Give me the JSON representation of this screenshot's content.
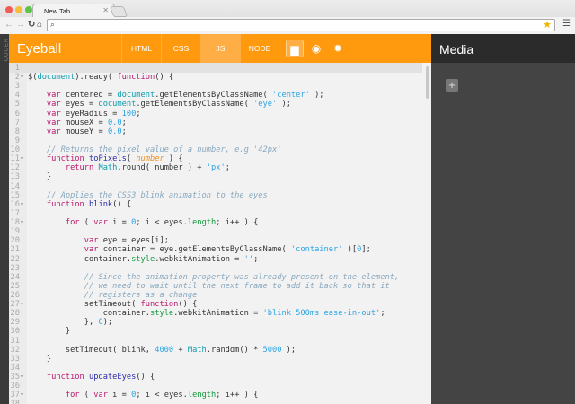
{
  "browser": {
    "tab_title": "New Tab",
    "url": ""
  },
  "sidebar_strip": {
    "label": "CODER"
  },
  "header": {
    "title": "Eyeball",
    "tabs": [
      "HTML",
      "CSS",
      "JS",
      "NODE"
    ],
    "active_tab": "JS",
    "accent": "#ff9a0f"
  },
  "media_panel": {
    "title": "Media",
    "add_label": "+"
  },
  "editor": {
    "active_line": 1,
    "warning_line": 29,
    "fold_lines": [
      2,
      11,
      16,
      18,
      27,
      35,
      37
    ],
    "lines": [
      [],
      [
        [
          "",
          "$("
        ],
        [
          "d",
          "document"
        ],
        [
          "",
          ").ready( "
        ],
        [
          "k",
          "function"
        ],
        [
          "",
          "() {"
        ]
      ],
      [],
      [
        [
          "",
          "    "
        ],
        [
          "k",
          "var"
        ],
        [
          "",
          " centered = "
        ],
        [
          "d",
          "document"
        ],
        [
          "",
          ".getElementsByClassName( "
        ],
        [
          "s",
          "'center'"
        ],
        [
          "",
          " );"
        ]
      ],
      [
        [
          "",
          "    "
        ],
        [
          "k",
          "var"
        ],
        [
          "",
          " eyes = "
        ],
        [
          "d",
          "document"
        ],
        [
          "",
          ".getElementsByClassName( "
        ],
        [
          "s",
          "'eye'"
        ],
        [
          "",
          " );"
        ]
      ],
      [
        [
          "",
          "    "
        ],
        [
          "k",
          "var"
        ],
        [
          "",
          " eyeRadius = "
        ],
        [
          "s",
          "100"
        ],
        [
          "",
          ";"
        ]
      ],
      [
        [
          "",
          "    "
        ],
        [
          "k",
          "var"
        ],
        [
          "",
          " mouseX = "
        ],
        [
          "s",
          "0.0"
        ],
        [
          "",
          ";"
        ]
      ],
      [
        [
          "",
          "    "
        ],
        [
          "k",
          "var"
        ],
        [
          "",
          " mouseY = "
        ],
        [
          "s",
          "0.0"
        ],
        [
          "",
          ";"
        ]
      ],
      [],
      [
        [
          "",
          "    "
        ],
        [
          "c",
          "// Returns the pixel value of a number, e.g '42px'"
        ]
      ],
      [
        [
          "",
          "    "
        ],
        [
          "k",
          "function"
        ],
        [
          "",
          " "
        ],
        [
          "f",
          "toPixels"
        ],
        [
          "",
          "( "
        ],
        [
          "p",
          "number"
        ],
        [
          "",
          " ) {"
        ]
      ],
      [
        [
          "",
          "        "
        ],
        [
          "k",
          "return"
        ],
        [
          "",
          " "
        ],
        [
          "d",
          "Math"
        ],
        [
          "",
          ".round( number ) + "
        ],
        [
          "s",
          "'px'"
        ],
        [
          "",
          ";"
        ]
      ],
      [
        [
          "",
          "    }"
        ]
      ],
      [],
      [
        [
          "",
          "    "
        ],
        [
          "c",
          "// Applies the CSS3 blink animation to the eyes"
        ]
      ],
      [
        [
          "",
          "    "
        ],
        [
          "k",
          "function"
        ],
        [
          "",
          " "
        ],
        [
          "f",
          "blink"
        ],
        [
          "",
          "() {"
        ]
      ],
      [],
      [
        [
          "",
          "        "
        ],
        [
          "k",
          "for"
        ],
        [
          "",
          " ( "
        ],
        [
          "k",
          "var"
        ],
        [
          "",
          " i = "
        ],
        [
          "s",
          "0"
        ],
        [
          "",
          "; i < eyes."
        ],
        [
          "g",
          "length"
        ],
        [
          "",
          "; i++ ) {"
        ]
      ],
      [],
      [
        [
          "",
          "            "
        ],
        [
          "k",
          "var"
        ],
        [
          "",
          " eye = eyes[i];"
        ]
      ],
      [
        [
          "",
          "            "
        ],
        [
          "k",
          "var"
        ],
        [
          "",
          " container = eye.getElementsByClassName( "
        ],
        [
          "s",
          "'container'"
        ],
        [
          "",
          " )["
        ],
        [
          "s",
          "0"
        ],
        [
          "",
          "];"
        ]
      ],
      [
        [
          "",
          "            container."
        ],
        [
          "g",
          "style"
        ],
        [
          "",
          ".webkitAnimation = "
        ],
        [
          "s",
          "''"
        ],
        [
          "",
          ";"
        ]
      ],
      [],
      [
        [
          "",
          "            "
        ],
        [
          "c",
          "// Since the animation property was already present on the element,"
        ]
      ],
      [
        [
          "",
          "            "
        ],
        [
          "c",
          "// we need to wait until the next frame to add it back so that it"
        ]
      ],
      [
        [
          "",
          "            "
        ],
        [
          "c",
          "// registers as a change"
        ]
      ],
      [
        [
          "",
          "            setTimeout( "
        ],
        [
          "k",
          "function"
        ],
        [
          "",
          "() {"
        ]
      ],
      [
        [
          "",
          "                container."
        ],
        [
          "g",
          "style"
        ],
        [
          "",
          ".webkitAnimation = "
        ],
        [
          "s",
          "'blink 500ms ease-in-out'"
        ],
        [
          "",
          ";"
        ]
      ],
      [
        [
          "",
          "            }, "
        ],
        [
          "s",
          "0"
        ],
        [
          "",
          ");"
        ]
      ],
      [
        [
          "",
          "        }"
        ]
      ],
      [],
      [
        [
          "",
          "        setTimeout( blink, "
        ],
        [
          "s",
          "4000"
        ],
        [
          "",
          " + "
        ],
        [
          "d",
          "Math"
        ],
        [
          "",
          ".random() * "
        ],
        [
          "s",
          "5000"
        ],
        [
          "",
          " );"
        ]
      ],
      [
        [
          "",
          "    }"
        ]
      ],
      [],
      [
        [
          "",
          "    "
        ],
        [
          "k",
          "function"
        ],
        [
          "",
          " "
        ],
        [
          "f",
          "updateEyes"
        ],
        [
          "",
          "() {"
        ]
      ],
      [],
      [
        [
          "",
          "        "
        ],
        [
          "k",
          "for"
        ],
        [
          "",
          " ( "
        ],
        [
          "k",
          "var"
        ],
        [
          "",
          " i = "
        ],
        [
          "s",
          "0"
        ],
        [
          "",
          "; i < eyes."
        ],
        [
          "g",
          "length"
        ],
        [
          "",
          "; i++ ) {"
        ]
      ],
      []
    ]
  }
}
